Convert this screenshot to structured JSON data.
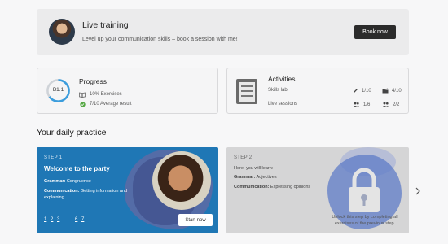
{
  "banner": {
    "title": "Live training",
    "subtitle": "Level up your communication skills – book a session with me!",
    "button": "Book now"
  },
  "progress": {
    "title": "Progress",
    "level": "B1.1",
    "level_fill": 0.65,
    "exercises": "10% Exercises",
    "average": "7/10 Average result"
  },
  "activities": {
    "title": "Activities",
    "rows": [
      {
        "name": "Skills lab",
        "v1": "1/10",
        "v2": "4/10"
      },
      {
        "name": "Live sessions",
        "v1": "1/6",
        "v2": "2/2"
      }
    ]
  },
  "daily": {
    "title": "Your daily practice",
    "step1": {
      "label": "STEP 1",
      "title": "Welcome to the party",
      "grammar_label": "Grammar:",
      "grammar": "Congruence",
      "communication_label": "Communication:",
      "communication": "Getting information and explaining",
      "steps": [
        "1",
        "2",
        "3",
        "",
        "6",
        "7"
      ],
      "button": "Start now"
    },
    "step2": {
      "label": "STEP 2",
      "intro": "Here, you will learn:",
      "grammar_label": "Grammar:",
      "grammar": "Adjectives",
      "communication_label": "Communication:",
      "communication": "Expressing opinions",
      "locked_note": "Unlock this step by completing all exercises of the previous step."
    }
  },
  "colors": {
    "step1_bg": "#1f77b5",
    "accent_ring": "#3b9ddd",
    "check_green": "#56a845",
    "button_dark": "#2b2b2b"
  }
}
